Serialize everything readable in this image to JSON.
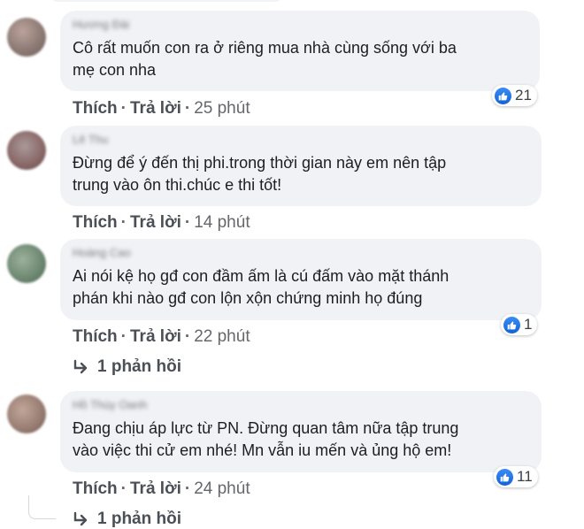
{
  "comments": [
    {
      "author": "Hương Đài",
      "text": "Cô rất muốn con ra ở riêng mua nhà cùng sống với ba\nmẹ con nha",
      "reaction_count": "21",
      "like": "Thích",
      "reply": "Trả lời",
      "time": "25 phút"
    },
    {
      "author": "Lê Thu",
      "text": "Đừng để ý đến thị phi.trong thời gian này em nên tập\ntrung vào ôn thi.chúc e thi tốt!",
      "reaction_count": "",
      "like": "Thích",
      "reply": "Trả lời",
      "time": "14 phút"
    },
    {
      "author": "Hoàng Cao",
      "text": "Ai nói kệ họ gđ con đầm ấm là cú đấm vào mặt thánh\nphán khi nào gđ con lộn xộn chứng minh họ đúng",
      "reaction_count": "1",
      "like": "Thích",
      "reply": "Trả lời",
      "time": "22 phút",
      "replies_label": "1 phản hồi"
    },
    {
      "author": "Hồ Thùy Oanh",
      "text": "Đang chịu áp lực từ PN. Đừng quan tâm nữa tập trung\nvào việc thi cử em nhé! Mn vẫn iu mến và ủng hộ em!",
      "reaction_count": "11",
      "like": "Thích",
      "reply": "Trả lời",
      "time": "24 phút",
      "replies_label": "1 phản hồi"
    }
  ],
  "colors": {
    "bubble": "#f0f2f5",
    "like_blue": "#1877f2",
    "action_text": "#65676b"
  },
  "icons": {
    "reaction": "like-thumb-icon",
    "reply_arrow": "reply-arrow-icon"
  }
}
